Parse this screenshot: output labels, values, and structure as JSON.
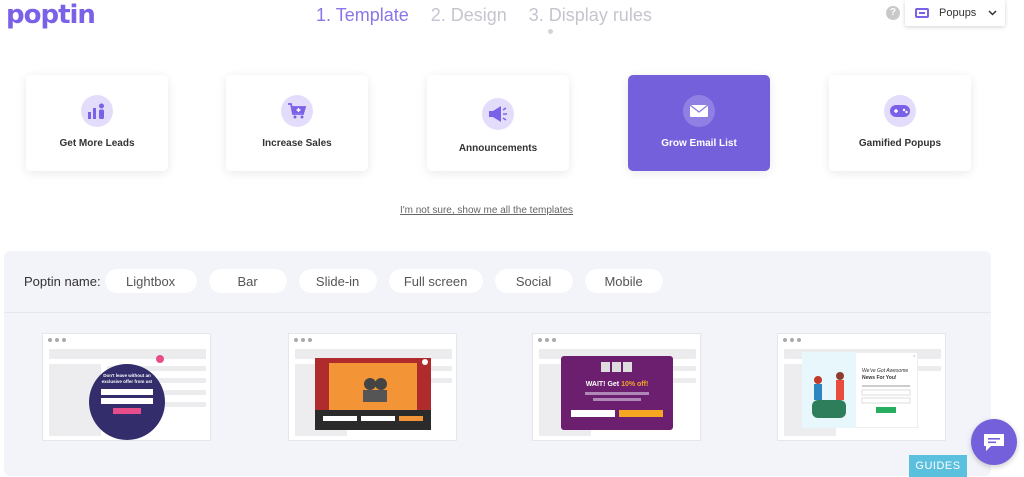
{
  "header": {
    "logo": "poptin",
    "steps": [
      "1. Template",
      "2. Design",
      "3. Display rules"
    ],
    "help": "?",
    "popup_select": {
      "label": "Popups",
      "chevron": "⌄"
    }
  },
  "categories": [
    {
      "label": "Get More Leads",
      "icon": "leads-chart-icon"
    },
    {
      "label": "Increase Sales",
      "icon": "cart-plus-icon"
    },
    {
      "label": "Announcements",
      "icon": "megaphone-icon"
    },
    {
      "label": "Grow Email List",
      "icon": "envelope-icon",
      "active": true
    },
    {
      "label": "Gamified Popups",
      "icon": "gamepad-icon"
    }
  ],
  "show_all_link": "I'm not sure, show me all the templates",
  "filters": {
    "name_label": "Poptin name:",
    "chips": [
      "Lightbox",
      "Bar",
      "Slide-in",
      "Full screen",
      "Social",
      "Mobile"
    ]
  },
  "templates": [
    {
      "kind": "lightbox",
      "heading": "Don't leave without an exclusive offer from us!",
      "button": "SUBSCRIBE"
    },
    {
      "kind": "bar",
      "heading": "Enter your details and we will let you know!",
      "button": "SUBMIT"
    },
    {
      "kind": "countdown",
      "digits": [
        "03",
        "14",
        "00"
      ],
      "heading": "WAIT! Get 10% off!",
      "button": "GET MY DISCOUNT"
    },
    {
      "kind": "news",
      "heading": "We've Got Awesome News For You!",
      "button": "SUBMIT"
    }
  ],
  "guides": "GUIDES",
  "colors": {
    "brand": "#7b61e8",
    "active_card": "#7460db",
    "guides": "#5bc0de"
  }
}
